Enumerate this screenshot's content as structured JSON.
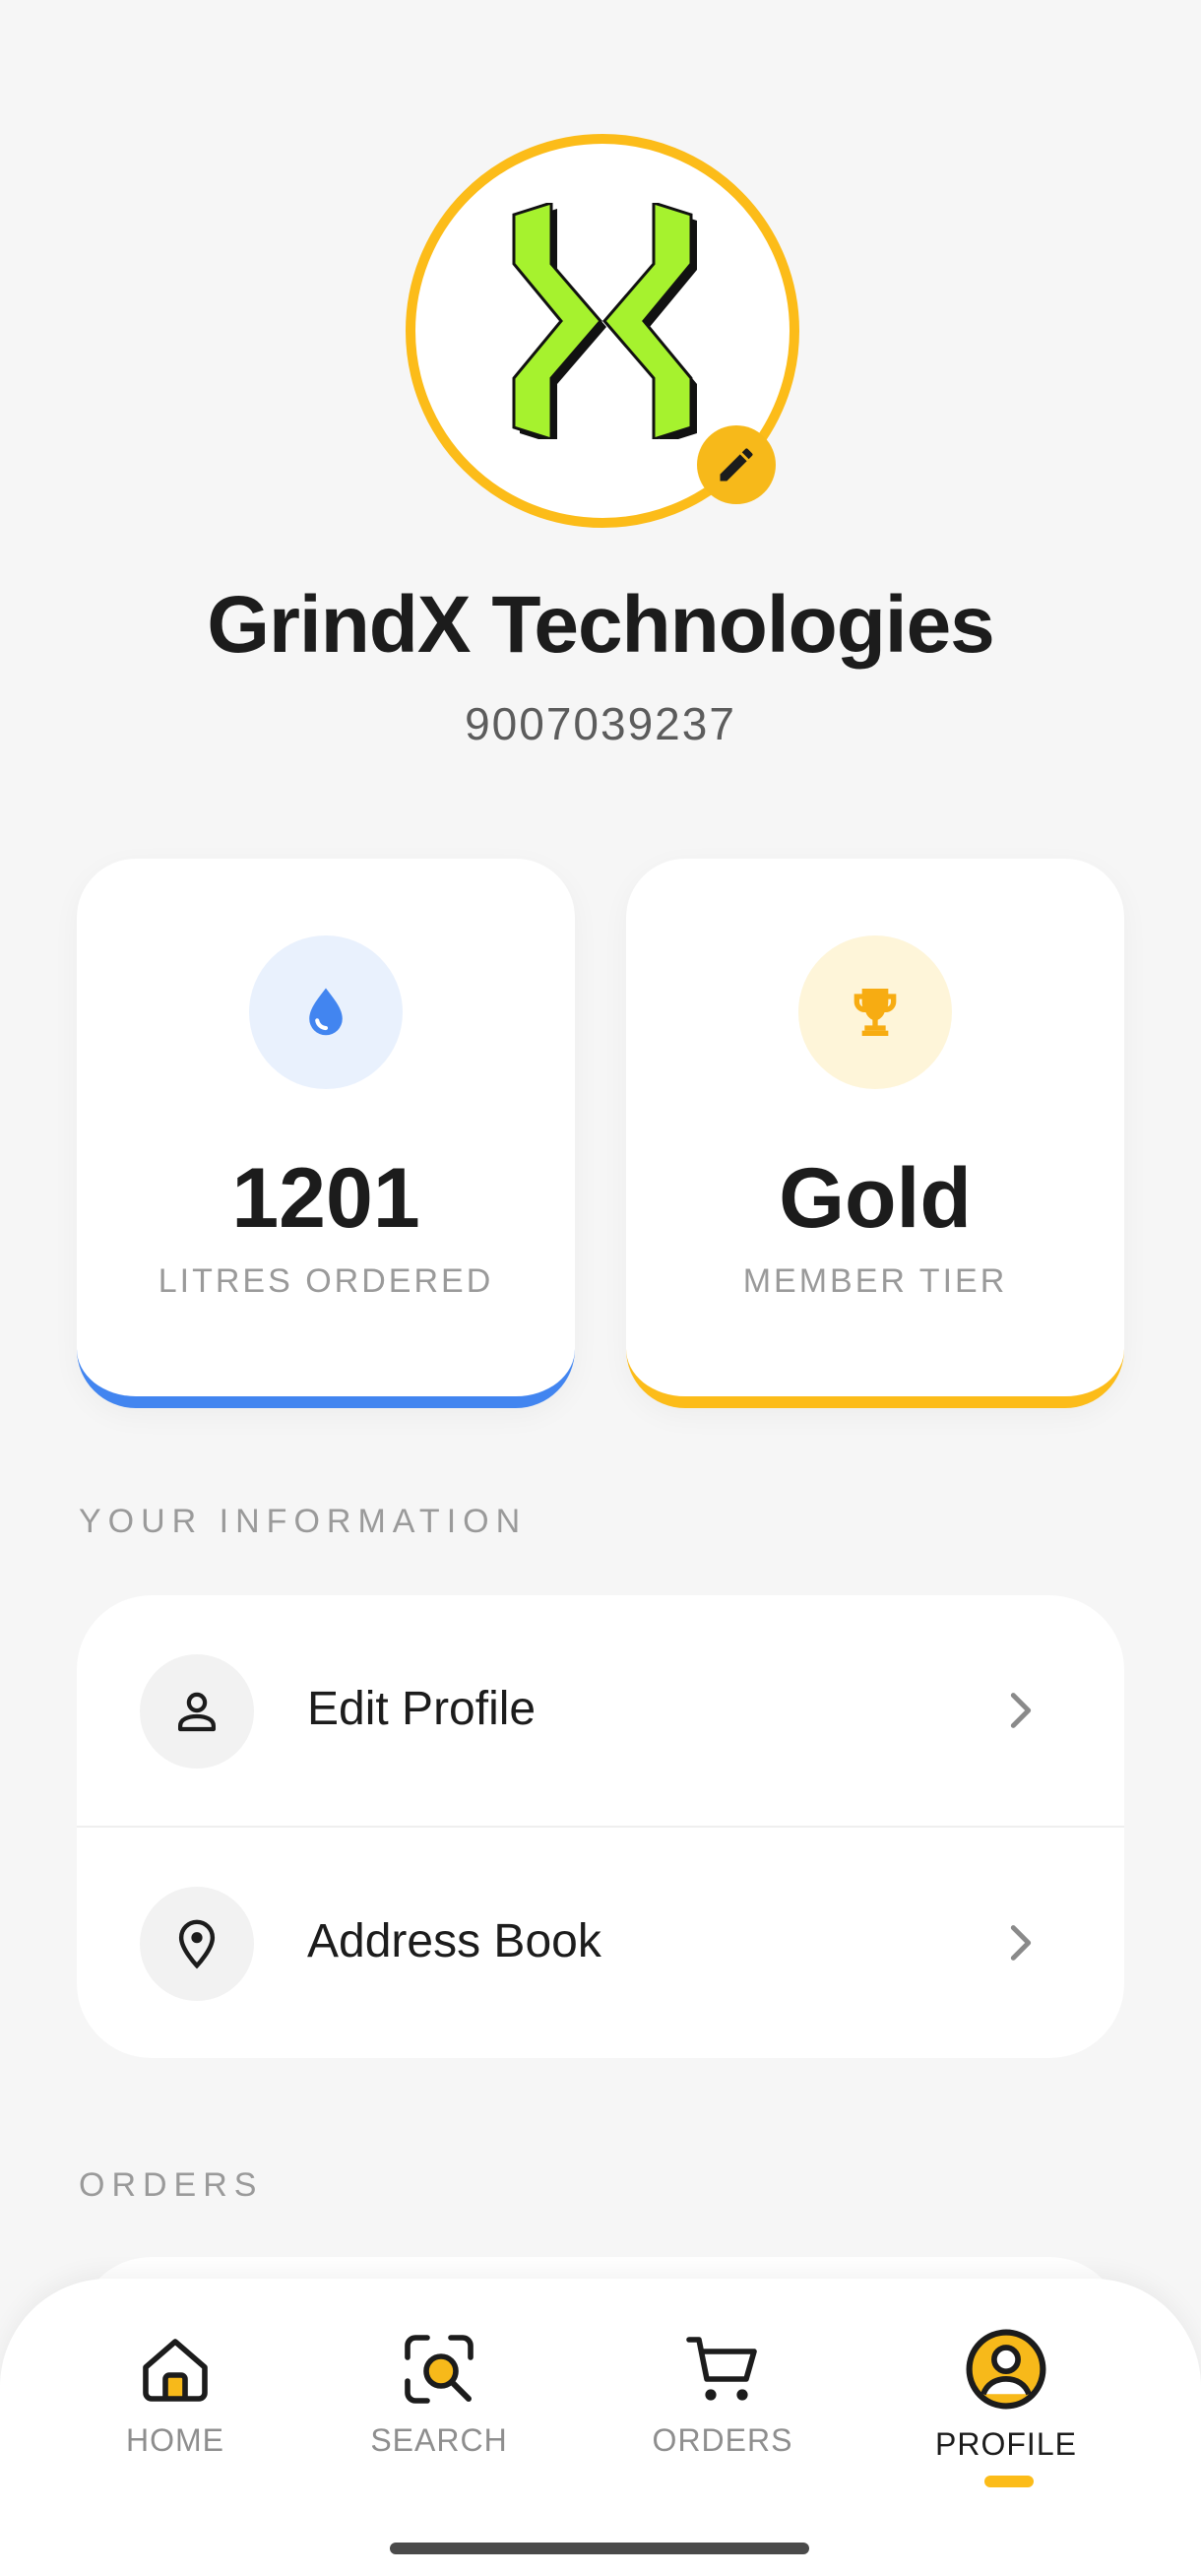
{
  "profile": {
    "company_name": "GrindX Technologies",
    "phone": "9007039237",
    "logo_icon": "grindx-x-logo",
    "edit_icon": "pencil-icon"
  },
  "stats": [
    {
      "value": "1201",
      "label": "LITRES ORDERED",
      "icon": "water-drop-icon",
      "accent": "#4285f0"
    },
    {
      "value": "Gold",
      "label": "MEMBER TIER",
      "icon": "trophy-icon",
      "accent": "#fcbc19"
    }
  ],
  "sections": {
    "info_title": "YOUR INFORMATION",
    "orders_title": "ORDERS"
  },
  "info_items": [
    {
      "label": "Edit Profile",
      "icon": "person-icon"
    },
    {
      "label": "Address Book",
      "icon": "location-pin-icon"
    }
  ],
  "nav": [
    {
      "label": "HOME",
      "icon": "home-icon",
      "active": false
    },
    {
      "label": "SEARCH",
      "icon": "search-scan-icon",
      "active": false
    },
    {
      "label": "ORDERS",
      "icon": "cart-icon",
      "active": false
    },
    {
      "label": "PROFILE",
      "icon": "profile-icon",
      "active": true
    }
  ],
  "colors": {
    "accent_yellow": "#fcbc19",
    "accent_blue": "#4285f0",
    "logo_green": "#a6f22e"
  }
}
